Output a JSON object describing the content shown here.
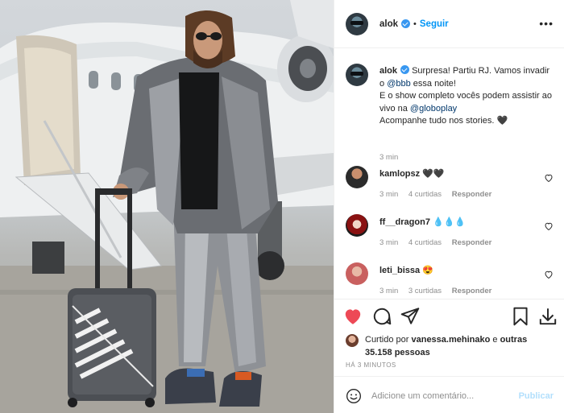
{
  "header": {
    "username": "alok",
    "separator": "•",
    "follow_label": "Seguir",
    "more_icon": "more-horizontal-icon"
  },
  "caption": {
    "username": "alok",
    "text_1": "Surpresa! Partiu RJ. Vamos invadir o ",
    "mention_1": "@bbb",
    "text_2": " essa noite!",
    "text_3": "E o show completo vocês podem assistir ao vivo na ",
    "mention_2": "@globoplay",
    "text_4": "Acompanhe tudo nos stories. ",
    "emoji": "🖤",
    "time": "3 min"
  },
  "comments": [
    {
      "username": "kamlopsz",
      "text": "🖤🖤",
      "time": "3 min",
      "likes": "4 curtidas",
      "reply": "Responder",
      "avatar_color": "#2b2b2b"
    },
    {
      "username": "ff__dragon7",
      "text": "💧💧💧",
      "time": "3 min",
      "likes": "4 curtidas",
      "reply": "Responder",
      "avatar_color": "#8a1212"
    },
    {
      "username": "leti_bissa",
      "text": "😍",
      "time": "3 min",
      "likes": "3 curtidas",
      "reply": "Responder",
      "avatar_color": "#c9605f"
    }
  ],
  "likes": {
    "prefix": "Curtido por ",
    "user": "vanessa.mehinako",
    "middle": " e ",
    "others": "outras 35.158 pessoas"
  },
  "timestamp": "HÁ 3 MINUTOS",
  "add_comment": {
    "placeholder": "Adicione um comentário...",
    "publish_label": "Publicar"
  },
  "colors": {
    "accent": "#0095f6",
    "like_red": "#ed4956",
    "verified": "#3897f0"
  }
}
